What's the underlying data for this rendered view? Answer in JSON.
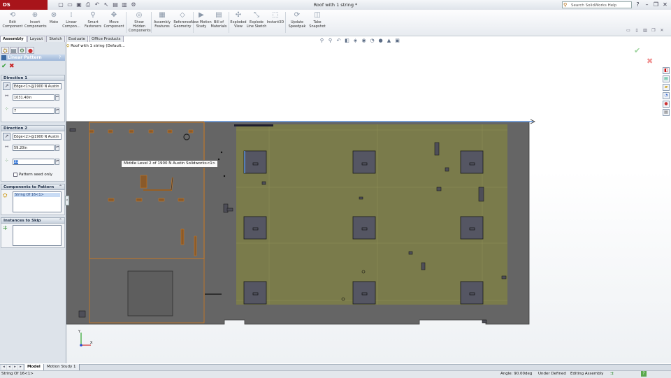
{
  "app": {
    "logo_text": "DS SOLIDWORKS",
    "document_title": "Roof with 1 string *",
    "search_placeholder": "Search SolidWorks Help"
  },
  "ribbon": {
    "buttons": [
      {
        "label": "Edit Component",
        "icon": "edit-component-icon"
      },
      {
        "label": "Insert Components",
        "icon": "insert-components-icon"
      },
      {
        "label": "Mate",
        "icon": "mate-icon"
      },
      {
        "label": "Linear Compon...",
        "icon": "linear-pattern-icon"
      },
      {
        "label": "Smart Fasteners",
        "icon": "smart-fasteners-icon"
      },
      {
        "label": "Move Component",
        "icon": "move-component-icon"
      },
      {
        "label": "Show Hidden Components",
        "icon": "show-hidden-icon"
      },
      {
        "label": "Assembly Features",
        "icon": "assembly-features-icon"
      },
      {
        "label": "Reference Geometry",
        "icon": "reference-geometry-icon"
      },
      {
        "label": "New Motion Study",
        "icon": "motion-study-icon"
      },
      {
        "label": "Bill of Materials",
        "icon": "bom-icon"
      },
      {
        "label": "Exploded View",
        "icon": "exploded-view-icon"
      },
      {
        "label": "Explode Line Sketch",
        "icon": "explode-line-icon"
      },
      {
        "label": "Instant3D",
        "icon": "instant3d-icon"
      },
      {
        "label": "Update Speedpak",
        "icon": "speedpak-icon"
      },
      {
        "label": "Take Snapshot",
        "icon": "snapshot-icon"
      }
    ]
  },
  "command_tabs": [
    "Assembly",
    "Layout",
    "Sketch",
    "Evaluate",
    "Office Products"
  ],
  "property_manager": {
    "title": "Linear Pattern",
    "help": "?",
    "direction1": {
      "title": "Direction 1",
      "edge": "Edge<1>@1900 N Austin",
      "spacing": "1031.40in",
      "instances": "7"
    },
    "direction2": {
      "title": "Direction 2",
      "edge": "Edge<2>@1900 N Austin",
      "spacing": "59.20in",
      "instances": "31",
      "seed_only_label": "Pattern seed only"
    },
    "components": {
      "title": "Components to Pattern",
      "items": [
        "String Of 16<1>"
      ]
    },
    "skip": {
      "title": "Instances to Skip"
    }
  },
  "graphics": {
    "tree_root": "Roof with 1 string  (Default...",
    "tooltip": "Middle Level 2 of 1900 N Austin Solidworks<1>",
    "triad_x": "X",
    "triad_y": "Y",
    "colors": {
      "roof": "#616161",
      "panel_area": "#7b7b4a",
      "selection": "#d07a1e",
      "blocks": "#565660"
    }
  },
  "bottom_tabs": [
    "Model",
    "Motion Study 1"
  ],
  "status": {
    "left": "String Of 16<1>",
    "angle": "Angle: 90.00deg",
    "state": "Under Defined",
    "mode": "Editing Assembly"
  }
}
